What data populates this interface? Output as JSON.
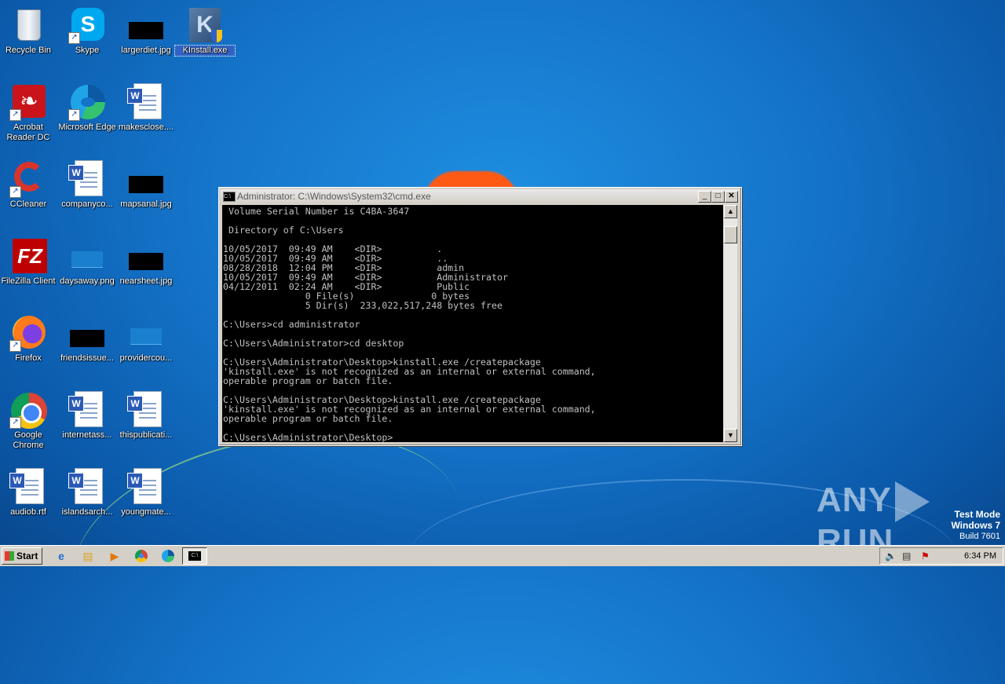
{
  "desktop_icons": [
    {
      "label": "Recycle Bin"
    },
    {
      "label": "Skype"
    },
    {
      "label": "largerdiet.jpg"
    },
    {
      "label": "KInstall.exe"
    },
    {
      "label": "Acrobat Reader DC"
    },
    {
      "label": "Microsoft Edge"
    },
    {
      "label": "makesclose...."
    },
    {
      "label": "CCleaner"
    },
    {
      "label": "companyco..."
    },
    {
      "label": "mapsanal.jpg"
    },
    {
      "label": "FileZilla Client"
    },
    {
      "label": "daysaway.png"
    },
    {
      "label": "nearsheet.jpg"
    },
    {
      "label": "Firefox"
    },
    {
      "label": "friendsissue..."
    },
    {
      "label": "providercou..."
    },
    {
      "label": "Google Chrome"
    },
    {
      "label": "internetass..."
    },
    {
      "label": "thispublicati..."
    },
    {
      "label": "audiob.rtf"
    },
    {
      "label": "islandsarch..."
    },
    {
      "label": "youngmate..."
    }
  ],
  "cmd_window": {
    "title": "Administrator: C:\\Windows\\System32\\cmd.exe",
    "output": " Volume Serial Number is C4BA-3647\n\n Directory of C:\\Users\n\n10/05/2017  09:49 AM    <DIR>          .\n10/05/2017  09:49 AM    <DIR>          ..\n08/28/2018  12:04 PM    <DIR>          admin\n10/05/2017  09:49 AM    <DIR>          Administrator\n04/12/2011  02:24 AM    <DIR>          Public\n               0 File(s)              0 bytes\n               5 Dir(s)  233,022,517,248 bytes free\n\nC:\\Users>cd administrator\n\nC:\\Users\\Administrator>cd desktop\n\nC:\\Users\\Administrator\\Desktop>kinstall.exe /createpackage\n'kinstall.exe' is not recognized as an internal or external command,\noperable program or batch file.\n\nC:\\Users\\Administrator\\Desktop>kinstall.exe /createpackage\n'kinstall.exe' is not recognized as an internal or external command,\noperable program or batch file.\n\nC:\\Users\\Administrator\\Desktop>"
  },
  "watermark": {
    "text_left": "ANY",
    "text_right": "RUN"
  },
  "test_mode": {
    "line1": "Test Mode",
    "line2": "Windows 7",
    "line3": "Build 7601"
  },
  "taskbar": {
    "start_label": "Start",
    "clock": "6:34 PM",
    "quick_launch": [
      "ie-icon",
      "explorer-icon",
      "media-player-icon",
      "chrome-icon",
      "edge-icon"
    ]
  }
}
